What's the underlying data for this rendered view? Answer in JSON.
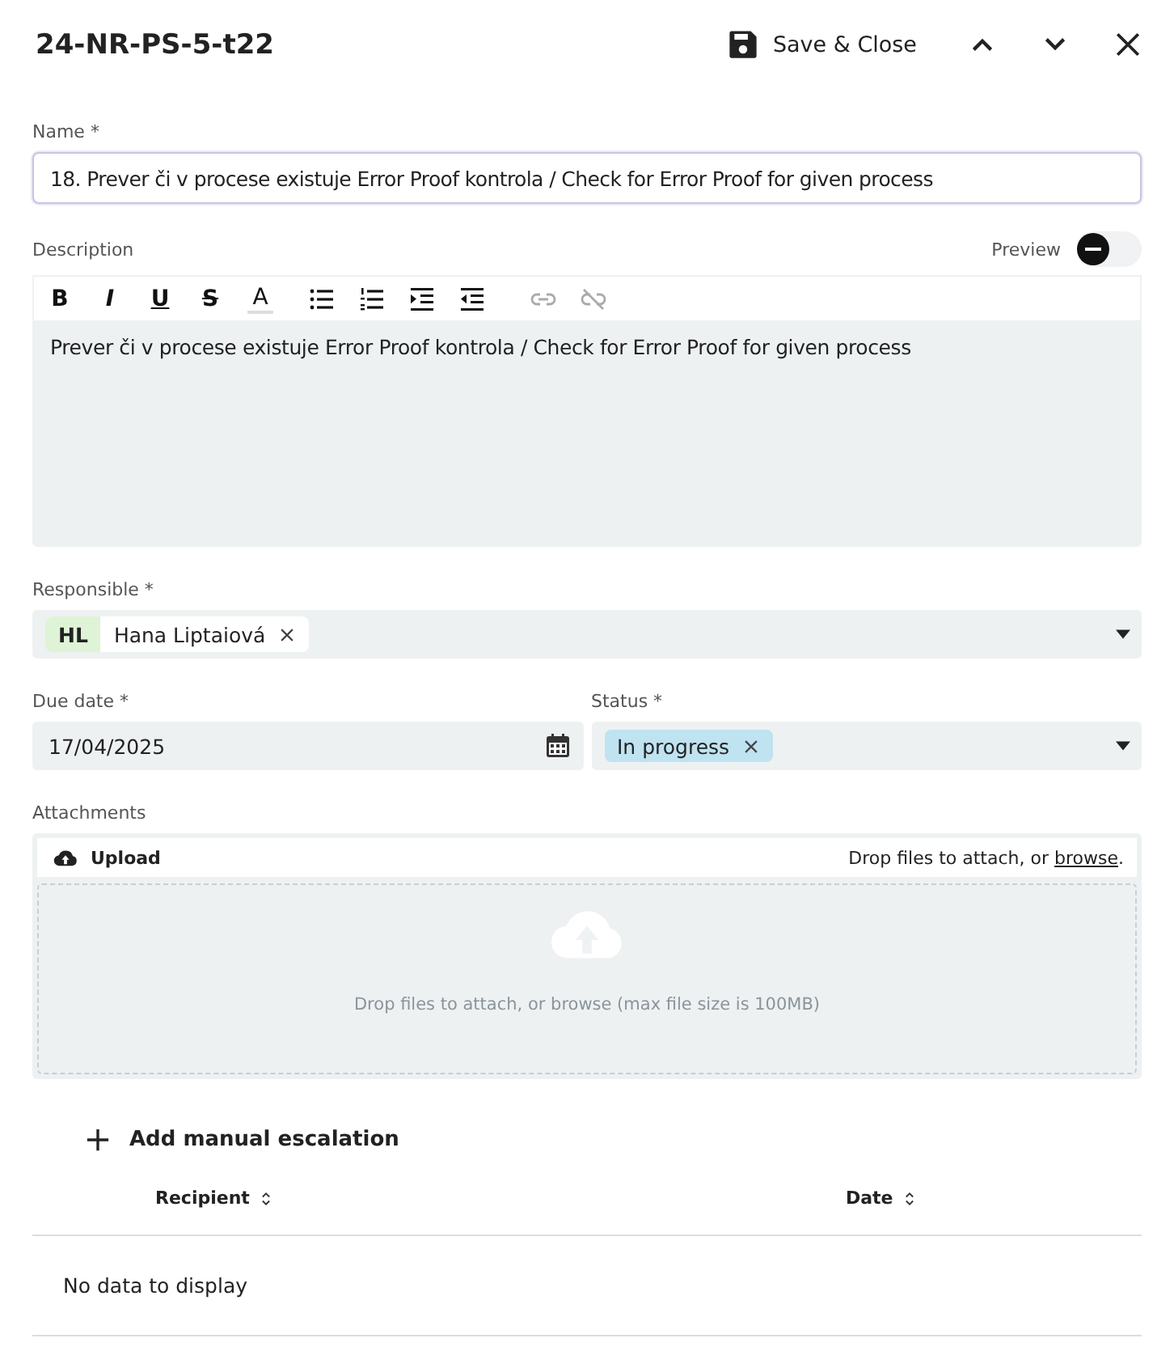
{
  "header": {
    "title": "24-NR-PS-5-t22",
    "save_label": "Save & Close"
  },
  "name_field": {
    "label": "Name *",
    "value": "18. Prever či v procese existuje Error Proof kontrola / Check for Error Proof for given process"
  },
  "description": {
    "label": "Description",
    "preview": {
      "label": "Preview",
      "on": false
    },
    "toolbar": [
      {
        "kind": "bold",
        "label": "B",
        "disabled": false
      },
      {
        "kind": "italic",
        "label": "I",
        "disabled": false
      },
      {
        "kind": "underline",
        "label": "U",
        "disabled": false
      },
      {
        "kind": "strike",
        "label": "S",
        "disabled": false
      },
      {
        "kind": "color",
        "label": "A",
        "disabled": false
      },
      {
        "kind": "bullets",
        "disabled": false
      },
      {
        "kind": "numbers",
        "disabled": false
      },
      {
        "kind": "indent",
        "disabled": false
      },
      {
        "kind": "outdent",
        "disabled": false
      },
      {
        "kind": "link",
        "disabled": true
      },
      {
        "kind": "unlink",
        "disabled": true
      }
    ],
    "text": "Prever či v procese existuje Error Proof kontrola / Check for Error Proof for given process"
  },
  "responsible": {
    "label": "Responsible *",
    "chips": [
      {
        "initials": "HL",
        "name": "Hana Liptaiová",
        "color": "#dff3d6"
      }
    ]
  },
  "due_date": {
    "label": "Due date *",
    "value": "17/04/2025"
  },
  "status": {
    "label": "Status *",
    "chips": [
      {
        "name": "In progress",
        "color": "#bfe3f0"
      }
    ]
  },
  "attachments": {
    "label": "Attachments",
    "upload": "Upload",
    "hint": "Drop files to attach, or ",
    "browse": "browse",
    "hint_end": ".",
    "drop_text": "Drop files to attach, or browse (max file size is 100MB)"
  },
  "escalation": {
    "add_label": "Add manual escalation",
    "columns": [
      "Recipient",
      "Date"
    ],
    "empty": "No data to display"
  }
}
